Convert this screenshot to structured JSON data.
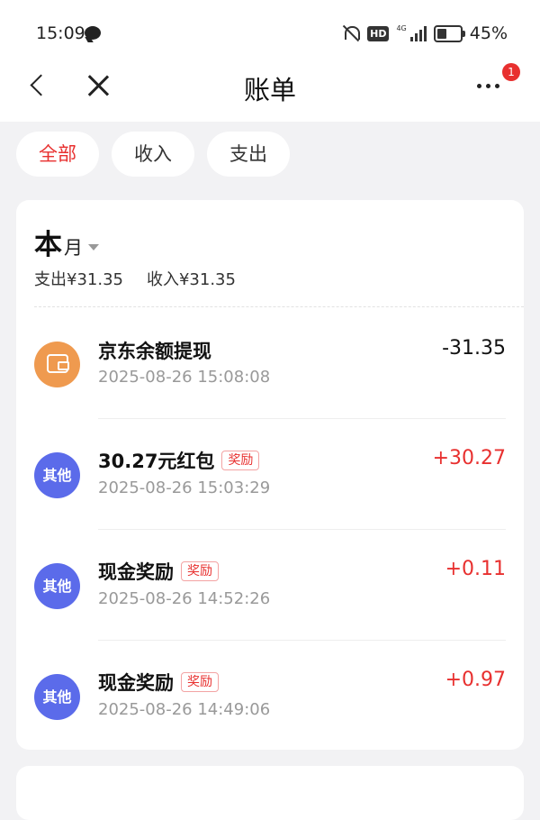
{
  "status_bar": {
    "time": "15:09",
    "hd": "HD",
    "network": "4G",
    "battery": "45%"
  },
  "nav": {
    "title": "账单",
    "badge_count": "1"
  },
  "filters": [
    {
      "label": "全部",
      "active": true
    },
    {
      "label": "收入",
      "active": false
    },
    {
      "label": "支出",
      "active": false
    }
  ],
  "period": {
    "big": "本",
    "small": "月"
  },
  "summary": {
    "expense": "支出¥31.35",
    "income": "收入¥31.35"
  },
  "transactions": [
    {
      "icon": "wallet-icon",
      "avatar_text": "",
      "title": "京东余额提现",
      "tag": "",
      "time": "2025-08-26 15:08:08",
      "amount": "-31.35",
      "sign": "neg"
    },
    {
      "icon": "other-icon",
      "avatar_text": "其他",
      "title": "30.27元红包",
      "tag": "奖励",
      "time": "2025-08-26 15:03:29",
      "amount": "+30.27",
      "sign": "pos"
    },
    {
      "icon": "other-icon",
      "avatar_text": "其他",
      "title": "现金奖励",
      "tag": "奖励",
      "time": "2025-08-26 14:52:26",
      "amount": "+0.11",
      "sign": "pos"
    },
    {
      "icon": "other-icon",
      "avatar_text": "其他",
      "title": "现金奖励",
      "tag": "奖励",
      "time": "2025-08-26 14:49:06",
      "amount": "+0.97",
      "sign": "pos"
    }
  ],
  "colors": {
    "accent": "#e8302f",
    "wallet": "#ef9a4f",
    "other": "#5b6bea",
    "background": "#f2f2f4"
  }
}
